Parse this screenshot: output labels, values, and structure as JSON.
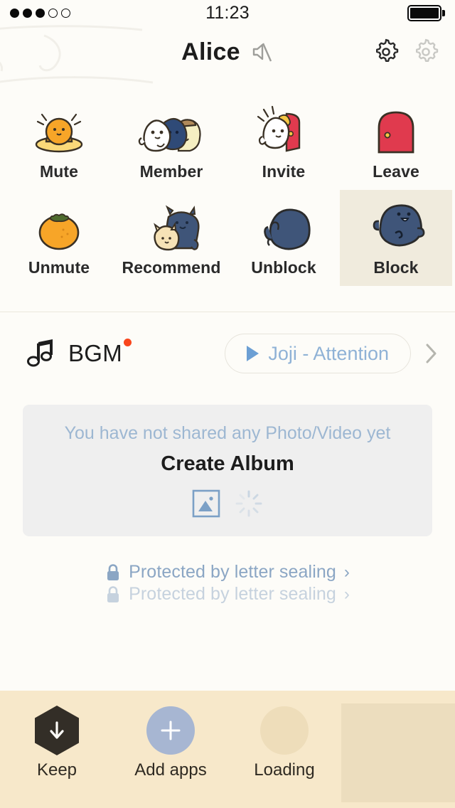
{
  "status_bar": {
    "signal_dots_filled": 3,
    "signal_dots_total": 5,
    "time": "11:23",
    "battery_level": 100
  },
  "header": {
    "title": "Alice",
    "mute_icon": "speaker-mute-icon",
    "settings_icon": "gear-icon",
    "settings_icon_disabled": "gear-icon-disabled"
  },
  "actions": [
    {
      "label": "Mute",
      "icon": "chick-on-egg-sticker",
      "active": false
    },
    {
      "label": "Member",
      "icon": "three-characters-sticker",
      "active": false
    },
    {
      "label": "Invite",
      "icon": "character-door-sticker",
      "active": false
    },
    {
      "label": "Leave",
      "icon": "red-door-sticker",
      "active": false
    },
    {
      "label": "Unmute",
      "icon": "orange-fruit-sticker",
      "active": false
    },
    {
      "label": "Recommend",
      "icon": "cat-hugging-sticker",
      "active": false
    },
    {
      "label": "Unblock",
      "icon": "blue-blob-back-sticker",
      "active": false
    },
    {
      "label": "Block",
      "icon": "blue-blob-face-sticker",
      "active": true
    }
  ],
  "bgm": {
    "icon": "music-note-icon",
    "label": "BGM",
    "has_new_badge": true,
    "badge_color": "#f9461c",
    "track": "Joji - Attention",
    "play_icon": "play-icon",
    "chevron_icon": "chevron-right-icon"
  },
  "album": {
    "empty_message": "You have not shared any Photo/Video yet",
    "title": "Create Album",
    "photo_icon": "photo-image-icon",
    "loading_icon": "spinner-icon"
  },
  "letter_sealing": [
    {
      "text": "Protected by letter sealing",
      "icon": "lock-icon",
      "state": "strong"
    },
    {
      "text": "Protected by letter sealing",
      "icon": "lock-icon",
      "state": "faded"
    }
  ],
  "bottom_bar": {
    "items": [
      {
        "label": "Keep",
        "icon": "keep-hexagon-download-icon"
      },
      {
        "label": "Add apps",
        "icon": "plus-circle-icon"
      },
      {
        "label": "Loading",
        "icon": "loading-circle-placeholder-icon"
      }
    ],
    "background_color": "#f7e8ca",
    "placeholder_color": "#ecddbe"
  },
  "colors": {
    "page_background": "#fdfcf8",
    "highlight_cell": "#f0ebdd",
    "album_card": "#efefef",
    "accent_blue": "#8fb2d6",
    "text_primary": "#1d1d1d"
  }
}
